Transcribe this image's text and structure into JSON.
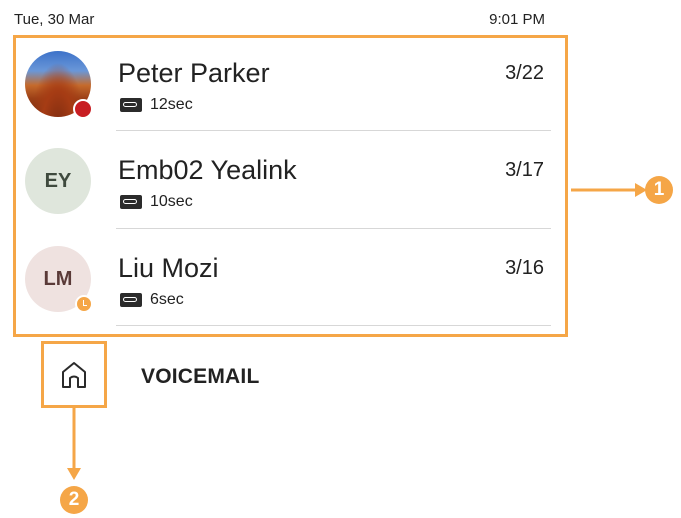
{
  "status": {
    "date": "Tue, 30 Mar",
    "time": "9:01 PM"
  },
  "voicemails": [
    {
      "avatar_initials": "",
      "avatar_type": "photo",
      "badge": "missed",
      "name": "Peter Parker",
      "duration": "12sec",
      "date": "3/22"
    },
    {
      "avatar_initials": "EY",
      "avatar_type": "initials",
      "badge": "none",
      "name": "Emb02 Yealink",
      "duration": "10sec",
      "date": "3/17"
    },
    {
      "avatar_initials": "LM",
      "avatar_type": "initials",
      "badge": "away",
      "name": "Liu Mozi",
      "duration": "6sec",
      "date": "3/16"
    }
  ],
  "page": {
    "title": "VOICEMAIL"
  },
  "callouts": {
    "list": "1",
    "home": "2"
  },
  "colors": {
    "highlight": "#f5a647",
    "missed_badge": "#c81e22",
    "divider": "#d7d7d7"
  },
  "icons": {
    "voicemail": "voicemail-icon",
    "home": "home-icon"
  }
}
